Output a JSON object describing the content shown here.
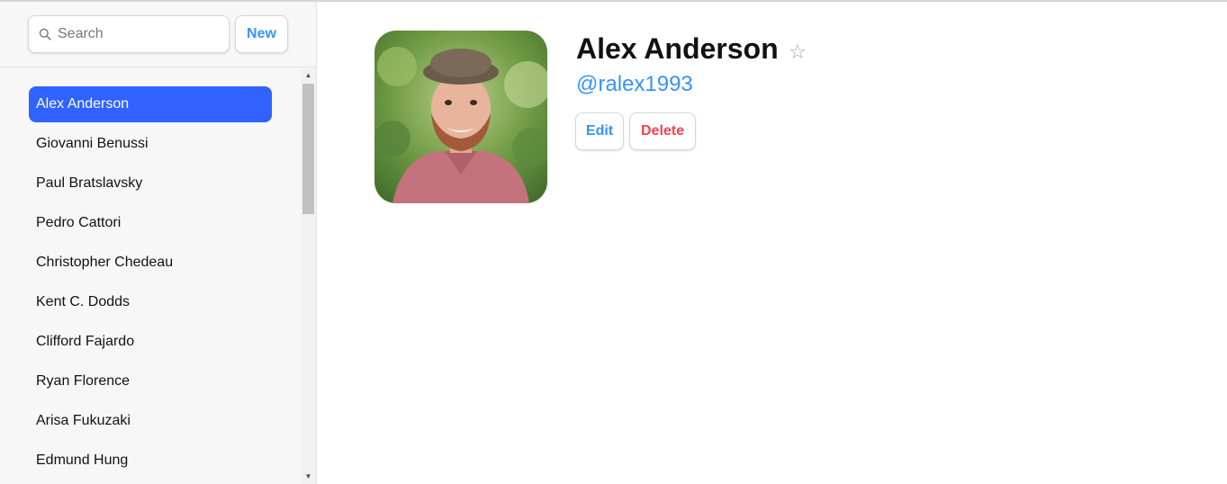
{
  "search": {
    "placeholder": "Search",
    "value": ""
  },
  "sidebar": {
    "new_label": "New",
    "contacts": [
      {
        "name": "Alex Anderson",
        "active": true
      },
      {
        "name": "Giovanni Benussi",
        "active": false
      },
      {
        "name": "Paul Bratslavsky",
        "active": false
      },
      {
        "name": "Pedro Cattori",
        "active": false
      },
      {
        "name": "Christopher Chedeau",
        "active": false
      },
      {
        "name": "Kent C. Dodds",
        "active": false
      },
      {
        "name": "Clifford Fajardo",
        "active": false
      },
      {
        "name": "Ryan Florence",
        "active": false
      },
      {
        "name": "Arisa Fukuzaki",
        "active": false
      },
      {
        "name": "Edmund Hung",
        "active": false
      }
    ]
  },
  "contact": {
    "name": "Alex Anderson",
    "star": "☆",
    "handle": "@ralex1993",
    "edit_label": "Edit",
    "delete_label": "Delete"
  },
  "colors": {
    "accent": "#3992ff",
    "active_item": "#2f62ff",
    "danger": "#f44250",
    "sidebar_bg": "#f7f7f7"
  },
  "icons": {
    "search": "search-icon",
    "star": "star-icon",
    "avatar": "avatar-photo"
  }
}
